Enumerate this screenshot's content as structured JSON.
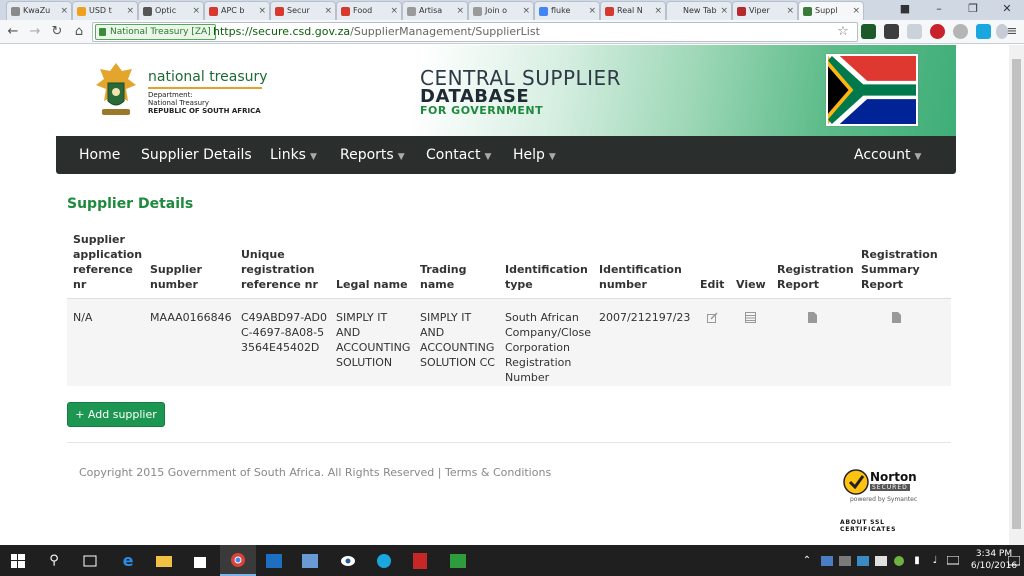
{
  "browser": {
    "tabs": [
      {
        "label": "KwaZu",
        "fav": "#8a8a8a"
      },
      {
        "label": "USD t",
        "fav": "#f0a020"
      },
      {
        "label": "Optic",
        "fav": "#555555"
      },
      {
        "label": "APC b",
        "fav": "#d63a2e"
      },
      {
        "label": "Secur",
        "fav": "#d63a2e"
      },
      {
        "label": "Food",
        "fav": "#d63a2e"
      },
      {
        "label": "Artisa",
        "fav": "#9a9a9a"
      },
      {
        "label": "Join o",
        "fav": "#9a9a9a"
      },
      {
        "label": "fluke",
        "fav": "#4285f4"
      },
      {
        "label": "Real N",
        "fav": "#d63a2e"
      },
      {
        "label": "New Tab",
        "fav": "#e6ebf1"
      },
      {
        "label": "Viper",
        "fav": "#b52a2a"
      },
      {
        "label": "Suppl",
        "fav": "#3a7a3a"
      }
    ],
    "secure_label": "National Treasury [ZA]",
    "url_host": "https://secure.csd.gov.za",
    "url_path": "/SupplierManagement/SupplierList"
  },
  "header": {
    "org_name": "national treasury",
    "dept_line1": "Department:",
    "dept_line2": "National Treasury",
    "dept_line3": "REPUBLIC OF SOUTH AFRICA",
    "csd_line1": "CENTRAL SUPPLIER",
    "csd_line2": "DATABASE",
    "csd_line3": "FOR GOVERNMENT"
  },
  "nav": {
    "home": "Home",
    "supplier_details": "Supplier Details",
    "links": "Links",
    "reports": "Reports",
    "contact": "Contact",
    "help": "Help",
    "account": "Account"
  },
  "main": {
    "title": "Supplier Details",
    "columns": [
      "Supplier application reference nr",
      "Supplier number",
      "Unique registration reference nr",
      "Legal name",
      "Trading name",
      "Identification type",
      "Identification number",
      "Edit",
      "View",
      "Registration Report",
      "Registration Summary Report"
    ],
    "rows": [
      {
        "app_ref": "N/A",
        "supplier_number": "MAAA0166846",
        "unique_ref": "C49ABD97-AD0C-4697-8A08-53564E45402D",
        "legal_name": "SIMPLY IT AND ACCOUNTING SOLUTION",
        "trading_name": "SIMPLY IT AND ACCOUNTING SOLUTION CC",
        "id_type": "South African Company/Close Corporation Registration Number",
        "id_number": "2007/212197/23"
      }
    ],
    "add_button": "+ Add supplier"
  },
  "footer": {
    "copyright": "Copyright 2015 Government of South Africa. All Rights Reserved | Terms & Conditions",
    "norton_name": "Norton",
    "norton_secured": "SECURED",
    "norton_powered": "powered by Symantec",
    "norton_about": "ABOUT SSL CERTIFICATES"
  },
  "taskbar": {
    "time": "3:34 PM",
    "date": "6/10/2016"
  }
}
